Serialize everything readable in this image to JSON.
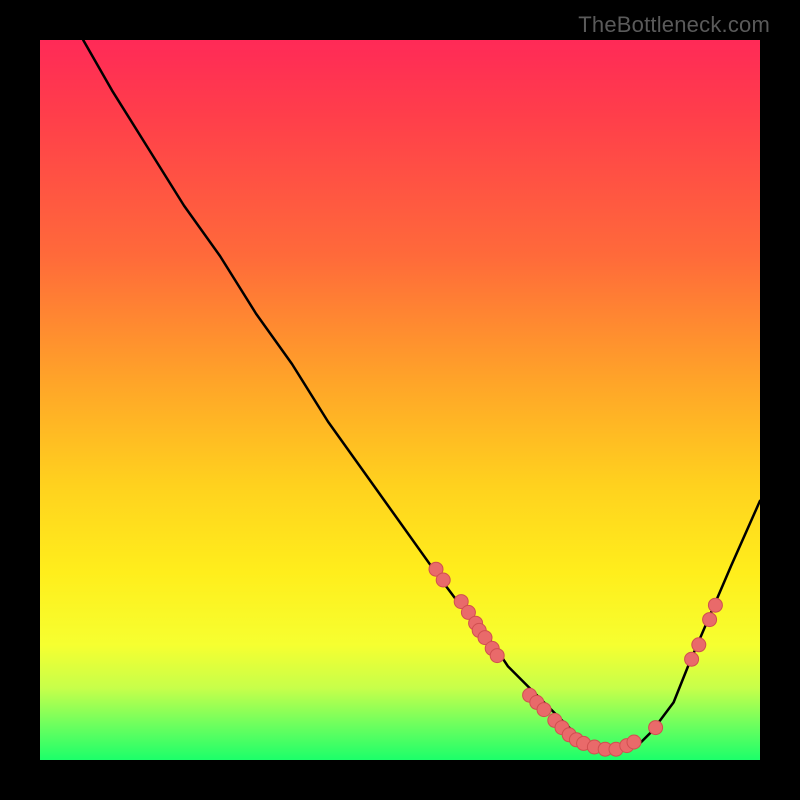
{
  "watermark": "TheBottleneck.com",
  "chart_data": {
    "type": "line",
    "title": "",
    "xlabel": "",
    "ylabel": "",
    "xlim": [
      0,
      100
    ],
    "ylim": [
      0,
      100
    ],
    "series": [
      {
        "name": "bottleneck-curve",
        "x": [
          6,
          10,
          15,
          20,
          25,
          30,
          35,
          40,
          45,
          50,
          55,
          58,
          60,
          63,
          65,
          68,
          70,
          73,
          75,
          78,
          80,
          83,
          85,
          88,
          90,
          93,
          96,
          100
        ],
        "values": [
          100,
          93,
          85,
          77,
          70,
          62,
          55,
          47,
          40,
          33,
          26,
          22,
          20,
          16,
          13,
          10,
          8,
          5,
          3,
          2,
          1,
          2,
          4,
          8,
          13,
          20,
          27,
          36
        ]
      }
    ],
    "markers": [
      {
        "x": 55.0,
        "y": 26.5
      },
      {
        "x": 56.0,
        "y": 25.0
      },
      {
        "x": 58.5,
        "y": 22.0
      },
      {
        "x": 59.5,
        "y": 20.5
      },
      {
        "x": 60.5,
        "y": 19.0
      },
      {
        "x": 61.0,
        "y": 18.0
      },
      {
        "x": 61.8,
        "y": 17.0
      },
      {
        "x": 62.8,
        "y": 15.5
      },
      {
        "x": 63.5,
        "y": 14.5
      },
      {
        "x": 68.0,
        "y": 9.0
      },
      {
        "x": 69.0,
        "y": 8.0
      },
      {
        "x": 70.0,
        "y": 7.0
      },
      {
        "x": 71.5,
        "y": 5.5
      },
      {
        "x": 72.5,
        "y": 4.5
      },
      {
        "x": 73.5,
        "y": 3.5
      },
      {
        "x": 74.5,
        "y": 2.8
      },
      {
        "x": 75.5,
        "y": 2.3
      },
      {
        "x": 77.0,
        "y": 1.8
      },
      {
        "x": 78.5,
        "y": 1.5
      },
      {
        "x": 80.0,
        "y": 1.5
      },
      {
        "x": 81.5,
        "y": 2.0
      },
      {
        "x": 82.5,
        "y": 2.5
      },
      {
        "x": 85.5,
        "y": 4.5
      },
      {
        "x": 90.5,
        "y": 14.0
      },
      {
        "x": 91.5,
        "y": 16.0
      },
      {
        "x": 93.0,
        "y": 19.5
      },
      {
        "x": 93.8,
        "y": 21.5
      }
    ],
    "colors": {
      "curve": "#000000",
      "marker_fill": "#e96a6a",
      "marker_stroke": "#d14f50"
    }
  }
}
